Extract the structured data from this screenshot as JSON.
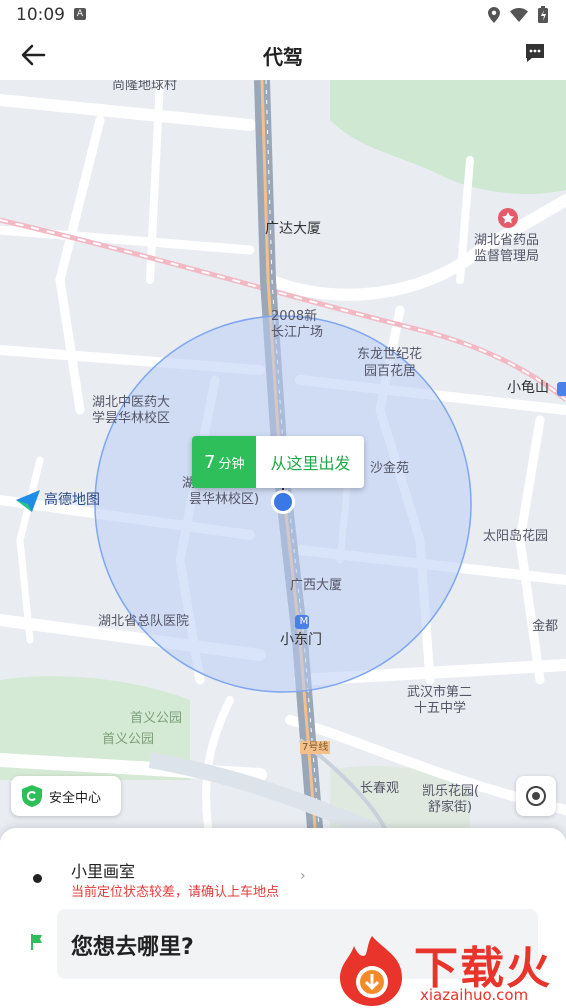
{
  "status_bar": {
    "time": "10:09",
    "notification_icon": "A"
  },
  "app_bar": {
    "title": "代驾"
  },
  "map": {
    "labels": {
      "shanglong": "尚隆地球村",
      "guangda": "广达大厦",
      "hubei_drug_1": "湖北省药品",
      "hubei_drug_2": "监督管理局",
      "changjiang_1": "2008新",
      "changjiang_2": "长江广场",
      "donglong_1": "东龙世纪花",
      "donglong_2": "园百花居",
      "xiaoguishan": "小龟山",
      "hubei_tcm_1": "湖北中医药大",
      "hubei_tcm_2": "学昙华林校区",
      "shajin": "沙金苑",
      "hubei_tcm_partial_1": "湖",
      "hubei_tcm_partial_2": "昙华林校区)",
      "gaode": "高德地图",
      "taiyangdao": "太阳岛花园",
      "guangxi": "广西大厦",
      "jindu": "金都",
      "zongdui": "湖北省总队医院",
      "xiaodongmen": "小东门",
      "school_1": "武汉市第二",
      "school_2": "十五中学",
      "shouyi_1": "首义公园",
      "shouyi_2": "首义公园",
      "line7": "7号线",
      "changchun": "长春观",
      "kaile_1": "凯乐花园(",
      "kaile_2": "舒家街)",
      "metro": "M"
    },
    "eta_minutes": "7",
    "eta_unit": "分钟",
    "start_here": "从这里出发",
    "safety_center": "安全中心"
  },
  "sheet": {
    "pickup_name": "小里画室",
    "pickup_warning": "当前定位状态较差，请确认上车地点",
    "destination_placeholder": "您想去哪里?"
  },
  "watermark": {
    "text": "下载火",
    "url": "xiazaihuo.com"
  },
  "colors": {
    "accent_green": "#2fbf5a",
    "warning_red": "#e53a3a",
    "radius_fill": "#b9cdf5"
  }
}
